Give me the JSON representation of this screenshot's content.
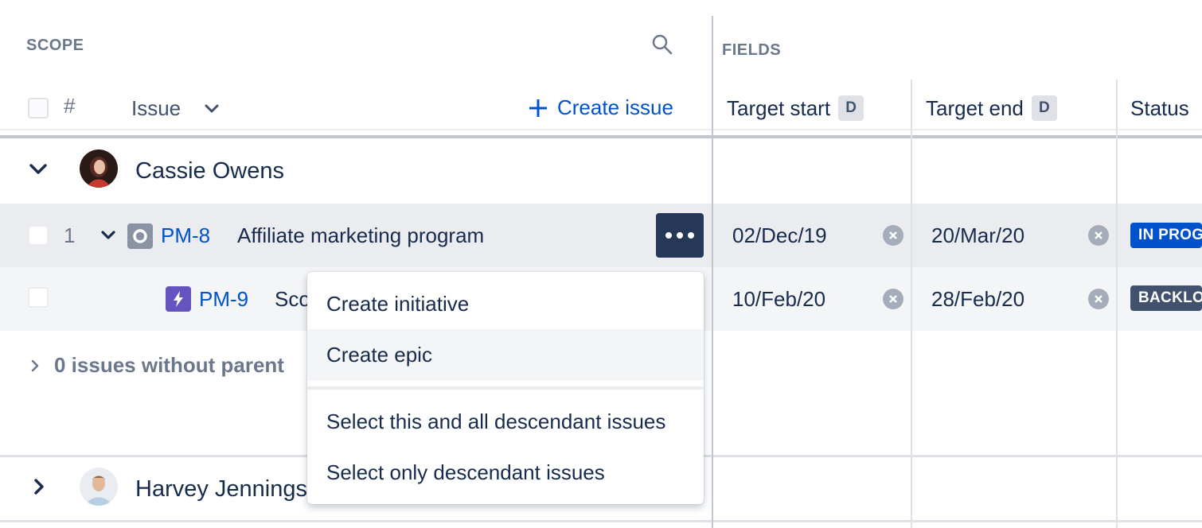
{
  "scope": {
    "title": "SCOPE",
    "columns": {
      "number": "#",
      "issue": "Issue",
      "create_issue": "Create issue"
    }
  },
  "fields": {
    "title": "FIELDS",
    "columns": [
      {
        "label": "Target start",
        "badge": "D"
      },
      {
        "label": "Target end",
        "badge": "D"
      },
      {
        "label": "Status"
      }
    ]
  },
  "groups": [
    {
      "name": "Cassie Owens",
      "expanded": true,
      "issues": [
        {
          "number": "1",
          "key": "PM-8",
          "summary": "Affiliate marketing program",
          "type_icon": "initiative-icon",
          "target_start": "02/Dec/19",
          "target_end": "20/Mar/20",
          "status": "IN PROGRESS",
          "status_color": "#0052cc"
        },
        {
          "number": "",
          "key": "PM-9",
          "summary": "Scope",
          "type_icon": "epic-icon",
          "target_start": "10/Feb/20",
          "target_end": "28/Feb/20",
          "status": "BACKLOG",
          "status_color": "#42526e"
        }
      ],
      "without_parent": "0 issues without parent"
    },
    {
      "name": "Harvey Jennings",
      "expanded": false
    }
  ],
  "context_menu": {
    "items": [
      {
        "label": "Create initiative",
        "highlighted": false
      },
      {
        "label": "Create epic",
        "highlighted": true
      },
      {
        "label": "Select this and all descendant issues",
        "highlighted": false
      },
      {
        "label": "Select only descendant issues",
        "highlighted": false
      }
    ]
  },
  "colors": {
    "accent": "#0052cc",
    "row_hover": "#ebecf0",
    "row_alt": "#f4f5f7",
    "menu_button": "#253858"
  }
}
